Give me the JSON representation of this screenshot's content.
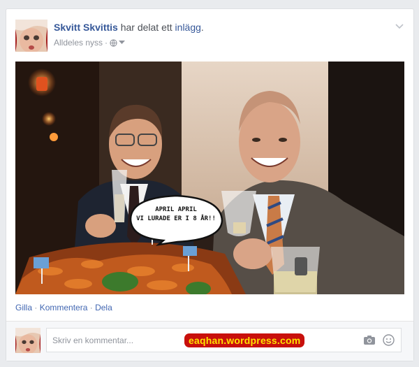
{
  "post": {
    "author": "Skvitt Skvittis",
    "action_text": "har delat ett",
    "post_link": "inlägg",
    "period": ".",
    "timestamp": "Alldeles nyss",
    "separator": "·"
  },
  "photo": {
    "bubble_line1": "APRIL APRIL",
    "bubble_line2": "VI LURADE ER I 8 ÅR!!"
  },
  "actions": {
    "like": "Gilla",
    "comment": "Kommentera",
    "share": "Dela",
    "sep": " · "
  },
  "comment_box": {
    "placeholder": "Skriv en kommentar...",
    "watermark": "eaqhan.wordpress.com"
  },
  "colors": {
    "link_blue": "#365899",
    "watermark_bg": "#c8100c",
    "watermark_text": "#ffe200"
  },
  "icons": {
    "privacy": "globe-icon",
    "dropdown": "caret-down-icon",
    "options": "chevron-down-icon",
    "photo_attach": "camera-icon",
    "emoticon": "smiley-icon"
  }
}
